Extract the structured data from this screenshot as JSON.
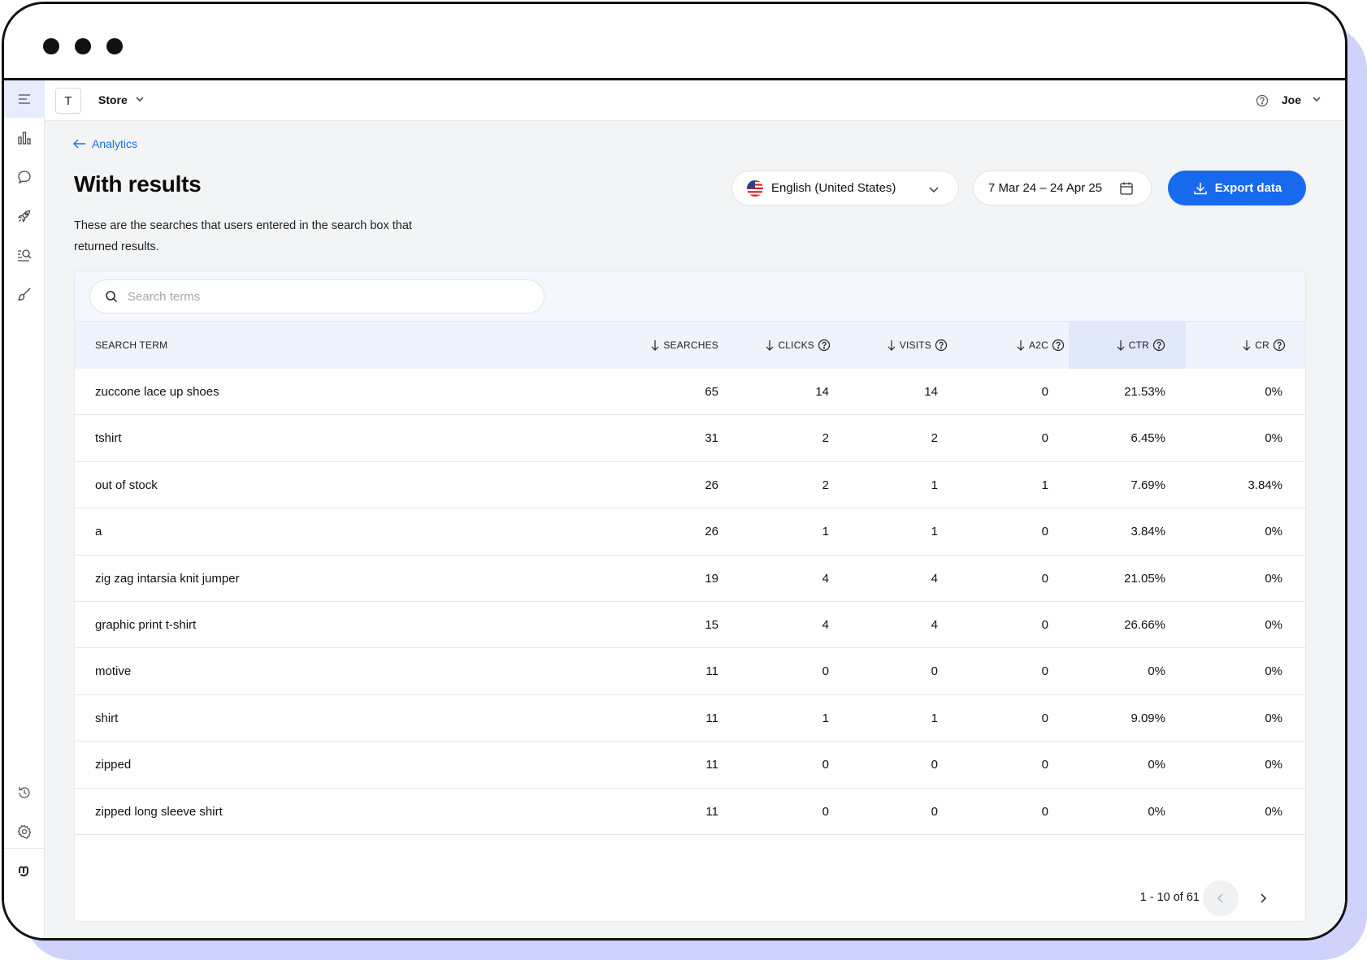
{
  "topbar": {
    "store_initial": "T",
    "store_name": "Store",
    "user_name": "Joe"
  },
  "page": {
    "back_label": "Analytics",
    "title": "With results",
    "description": "These are the searches that users entered in the search box that returned results."
  },
  "filters": {
    "language": "English (United States)",
    "date_range": "7 Mar 24 – 24 Apr 25",
    "export_label": "Export data"
  },
  "search": {
    "placeholder": "Search terms",
    "value": ""
  },
  "table": {
    "columns": [
      {
        "key": "term",
        "label": "SEARCH TERM",
        "sortable": false,
        "help": false
      },
      {
        "key": "searches",
        "label": "SEARCHES",
        "sortable": true,
        "help": false
      },
      {
        "key": "clicks",
        "label": "CLICKS",
        "sortable": true,
        "help": true
      },
      {
        "key": "visits",
        "label": "VISITS",
        "sortable": true,
        "help": true
      },
      {
        "key": "a2c",
        "label": "A2C",
        "sortable": true,
        "help": true
      },
      {
        "key": "ctr",
        "label": "CTR",
        "sortable": true,
        "help": true
      },
      {
        "key": "cr",
        "label": "CR",
        "sortable": true,
        "help": true
      }
    ],
    "rows": [
      {
        "term": "zuccone lace up shoes",
        "searches": "65",
        "clicks": "14",
        "visits": "14",
        "a2c": "0",
        "ctr": "21.53%",
        "cr": "0%"
      },
      {
        "term": "tshirt",
        "searches": "31",
        "clicks": "2",
        "visits": "2",
        "a2c": "0",
        "ctr": "6.45%",
        "cr": "0%"
      },
      {
        "term": "out of stock",
        "searches": "26",
        "clicks": "2",
        "visits": "1",
        "a2c": "1",
        "ctr": "7.69%",
        "cr": "3.84%"
      },
      {
        "term": "a",
        "searches": "26",
        "clicks": "1",
        "visits": "1",
        "a2c": "0",
        "ctr": "3.84%",
        "cr": "0%"
      },
      {
        "term": "zig zag intarsia knit jumper",
        "searches": "19",
        "clicks": "4",
        "visits": "4",
        "a2c": "0",
        "ctr": "21.05%",
        "cr": "0%"
      },
      {
        "term": "graphic print t-shirt",
        "searches": "15",
        "clicks": "4",
        "visits": "4",
        "a2c": "0",
        "ctr": "26.66%",
        "cr": "0%"
      },
      {
        "term": "motive",
        "searches": "11",
        "clicks": "0",
        "visits": "0",
        "a2c": "0",
        "ctr": "0%",
        "cr": "0%"
      },
      {
        "term": "shirt",
        "searches": "11",
        "clicks": "1",
        "visits": "1",
        "a2c": "0",
        "ctr": "9.09%",
        "cr": "0%"
      },
      {
        "term": "zipped",
        "searches": "11",
        "clicks": "0",
        "visits": "0",
        "a2c": "0",
        "ctr": "0%",
        "cr": "0%"
      },
      {
        "term": "zipped long sleeve shirt",
        "searches": "11",
        "clicks": "0",
        "visits": "0",
        "a2c": "0",
        "ctr": "0%",
        "cr": "0%"
      }
    ],
    "pagination": "1 - 10 of 61"
  },
  "colors": {
    "accent": "#1769ee",
    "background": "#f3f4f6",
    "header_bg": "#eef3fc",
    "frame_shadow": "#cfd2fb"
  },
  "icons": {
    "sidebar_top": [
      "menu-icon",
      "bar-chart-icon",
      "chat-icon",
      "rocket-icon",
      "search-list-icon",
      "brush-icon"
    ],
    "sidebar_bottom": [
      "history-icon",
      "settings-icon",
      "brand-logo-icon"
    ]
  }
}
